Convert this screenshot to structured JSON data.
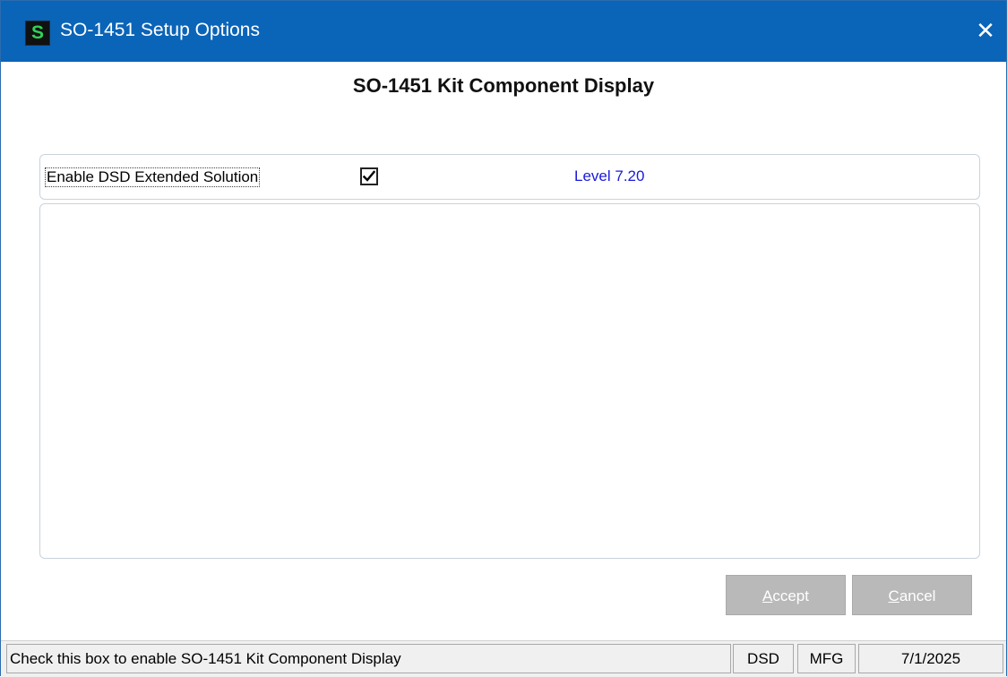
{
  "window": {
    "title": "SO-1451 Setup Options",
    "app_icon_letter": "S",
    "close_glyph": "✕"
  },
  "heading": "SO-1451 Kit Component Display",
  "options": {
    "enable_label": "Enable DSD Extended Solution",
    "enable_checked": true,
    "level_text": "Level  7.20"
  },
  "buttons": {
    "accept_mnemonic": "A",
    "accept_rest": "ccept",
    "cancel_mnemonic": "C",
    "cancel_rest": "ancel"
  },
  "statusbar": {
    "message": "Check this box to enable SO-1451 Kit Component Display",
    "cell1": "DSD",
    "cell2": "MFG",
    "date": "7/1/2025"
  },
  "colors": {
    "titlebar": "#0a64b8",
    "level_text": "#1a1adb",
    "button_bg": "#b9b9b9"
  }
}
